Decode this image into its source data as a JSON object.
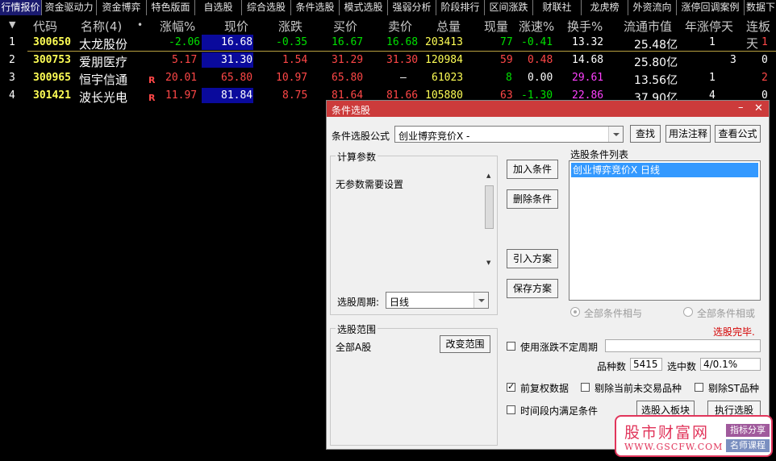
{
  "tabs": [
    "行情报价",
    "资金驱动力",
    "资金博弈",
    "特色版面",
    "自选股",
    "综合选股",
    "条件选股",
    "模式选股",
    "强弱分析",
    "阶段排行",
    "区间涨跌",
    "财联社",
    "龙虎榜",
    "外资流向",
    "涨停回调案例",
    "数据下"
  ],
  "headers": {
    "code": "代码",
    "name": "名称(4)",
    "dot": "•",
    "change_pct": "涨幅%",
    "price": "现价",
    "change": "涨跌",
    "bid": "买价",
    "ask": "卖价",
    "volume": "总量",
    "last_vol": "现量",
    "speed": "涨速%",
    "turnover": "换手%",
    "mktcap": "流通市值",
    "year_limit": "年涨停天",
    "consec": "连板天"
  },
  "rows": [
    {
      "idx": "1",
      "code": "300650",
      "name": "太龙股份",
      "r": "",
      "change_pct": "-2.06",
      "price": "16.68",
      "change": "-0.35",
      "bid": "16.67",
      "ask": "16.68",
      "volume": "203413",
      "last_vol": "77",
      "speed": "-0.41",
      "turnover": "13.32",
      "mktcap": "25.48亿",
      "year_limit": "1",
      "consec": "1"
    },
    {
      "idx": "2",
      "code": "300753",
      "name": "爱朋医疗",
      "r": "",
      "change_pct": "5.17",
      "price": "31.30",
      "change": "1.54",
      "bid": "31.29",
      "ask": "31.30",
      "volume": "120984",
      "last_vol": "59",
      "speed": "0.48",
      "turnover": "14.68",
      "mktcap": "25.80亿",
      "year_limit": "3",
      "consec": "0"
    },
    {
      "idx": "3",
      "code": "300965",
      "name": "恒宇信通",
      "r": "R",
      "change_pct": "20.01",
      "price": "65.80",
      "change": "10.97",
      "bid": "65.80",
      "ask": "—",
      "volume": "61023",
      "last_vol": "8",
      "speed": "0.00",
      "turnover": "29.61",
      "mktcap": "13.56亿",
      "year_limit": "1",
      "consec": "2"
    },
    {
      "idx": "4",
      "code": "301421",
      "name": "波长光电",
      "r": "R",
      "change_pct": "11.97",
      "price": "81.84",
      "change": "8.75",
      "bid": "81.64",
      "ask": "81.66",
      "volume": "105880",
      "last_vol": "63",
      "speed": "-1.30",
      "turnover": "22.86",
      "mktcap": "37.90亿",
      "year_limit": "4",
      "consec": "0"
    }
  ],
  "dialog": {
    "title": "条件选股",
    "formula_label": "条件选股公式",
    "formula_value": "创业博弈竞价X  -",
    "btn_find": "查找",
    "btn_usage": "用法注释",
    "btn_view": "查看公式",
    "params_group": "计算参数",
    "params_text": "无参数需要设置",
    "period_label": "选股周期:",
    "period_value": "日线",
    "btn_add": "加入条件",
    "btn_delete": "删除条件",
    "btn_import": "引入方案",
    "btn_save": "保存方案",
    "list_label": "选股条件列表",
    "list_item": "创业博弈竞价X  日线",
    "radio_and": "全部条件相与",
    "radio_or": "全部条件相或",
    "status": "选股完毕.",
    "scope_group": "选股范围",
    "scope_text": "全部A股",
    "btn_change_scope": "改变范围",
    "chk_period": "使用涨跌不定周期",
    "count_label": "品种数",
    "count_value": "5415",
    "selected_label": "选中数",
    "selected_value": "4/0.1%",
    "chk_adjust": "前复权数据",
    "chk_exclude_untraded": "剔除当前未交易品种",
    "chk_exclude_st": "剔除ST品种",
    "chk_time": "时间段内满足条件",
    "btn_to_block": "选股入板块",
    "btn_execute": "执行选股"
  },
  "watermark": {
    "title": "股市财富网",
    "url": "WWW.GSCFW.COM",
    "tag1": "指标分享",
    "tag2": "名师课程"
  },
  "colors": {
    "up": "#ff4747",
    "down": "#00e000",
    "code": "#ffff55",
    "title_bar": "#cc3b3b",
    "selection": "#3399ff"
  }
}
